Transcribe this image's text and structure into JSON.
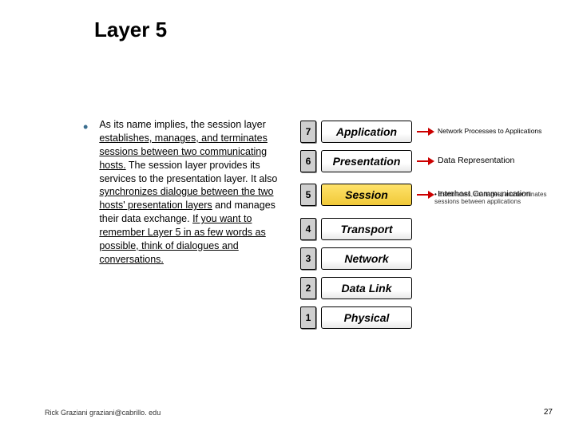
{
  "title": "Layer 5",
  "bullet_glyph": "•",
  "paragraph": {
    "t1": "As its name implies, the session layer ",
    "u1": "establishes, manages, and terminates sessions between two communicating hosts.",
    "t2": " The session layer provides its services to the presentation layer. It also ",
    "u2": "synchronizes dialogue between the two hosts' presentation layers",
    "t3": " and manages their data exchange. ",
    "u3": "If you want to remember Layer 5 in as few words as possible, think of dialogues and conversations."
  },
  "layers": [
    {
      "num": "7",
      "name": "Application",
      "hl": false,
      "desc": "Network Processes to Applications",
      "sub": ""
    },
    {
      "num": "6",
      "name": "Presentation",
      "hl": false,
      "desc": "Data Representation",
      "sub": ""
    },
    {
      "num": "5",
      "name": "Session",
      "hl": true,
      "desc": "Interhost Communication",
      "sub": "Establishes, manages, and terminates sessions between applications"
    },
    {
      "num": "4",
      "name": "Transport",
      "hl": false,
      "desc": "",
      "sub": ""
    },
    {
      "num": "3",
      "name": "Network",
      "hl": false,
      "desc": "",
      "sub": ""
    },
    {
      "num": "2",
      "name": "Data Link",
      "hl": false,
      "desc": "",
      "sub": ""
    },
    {
      "num": "1",
      "name": "Physical",
      "hl": false,
      "desc": "",
      "sub": ""
    }
  ],
  "footer": {
    "left": "Rick Graziani graziani@cabrillo. edu",
    "right": "27"
  }
}
